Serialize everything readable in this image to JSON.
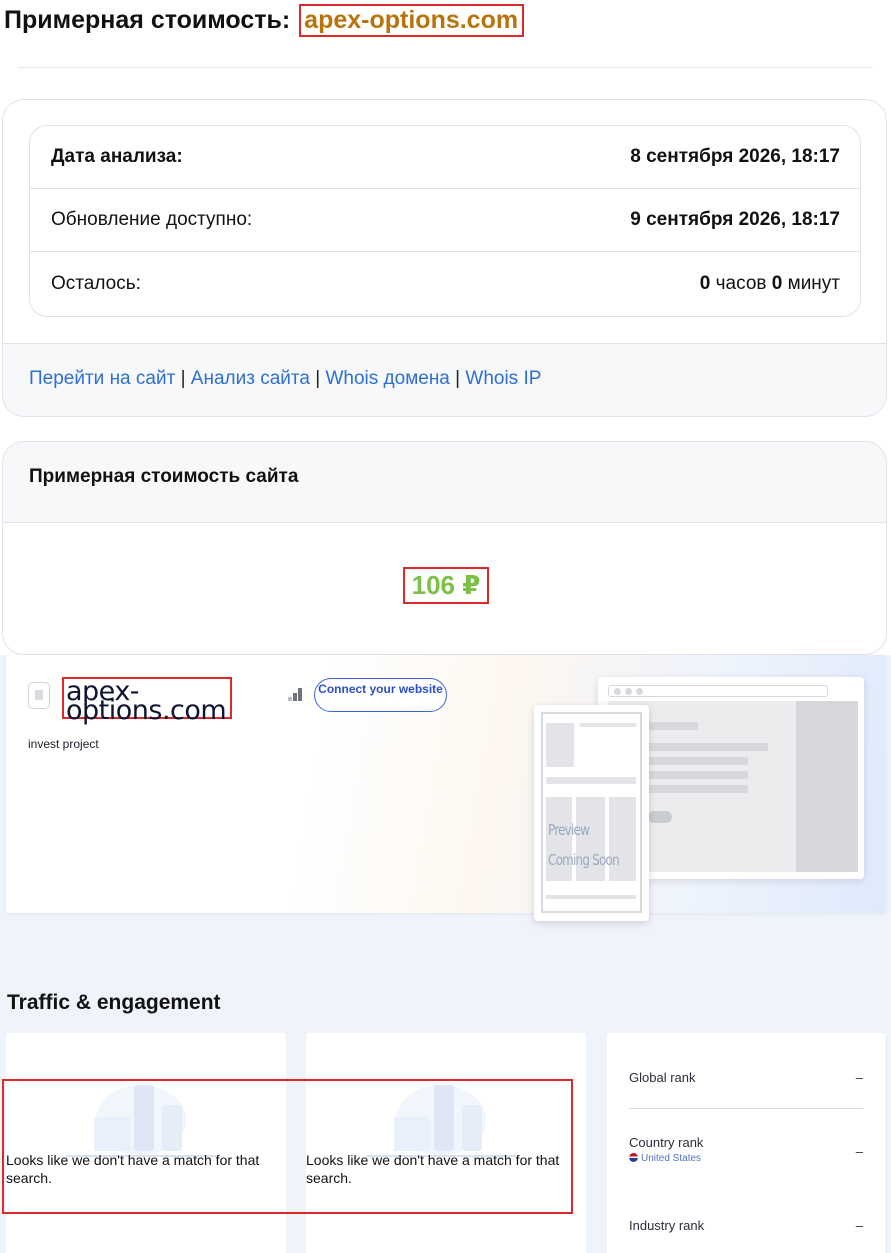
{
  "header": {
    "title_prefix": "Примерная стоимость:",
    "domain": "apex-options.com"
  },
  "analysis": {
    "date_label": "Дата анализа:",
    "date_value": "8 сентября 2026, 18:17",
    "update_label": "Обновление доступно:",
    "update_value": "9 сентября 2026, 18:17",
    "remaining_label": "Осталось:",
    "hours_value": "0",
    "hours_unit": "часов",
    "minutes_value": "0",
    "minutes_unit": "минут"
  },
  "links": {
    "goto_site": "Перейти на сайт",
    "site_analysis": "Анализ сайта",
    "whois_domain": "Whois домена",
    "whois_ip": "Whois IP",
    "separator": "|"
  },
  "value_card": {
    "title": "Примерная стоимость сайта",
    "price": "106 ₽"
  },
  "similarweb": {
    "domain": "apex-options.com",
    "connect_button": "Connect your website",
    "description": "invest project",
    "preview_line1": "Preview",
    "preview_line2": "Coming Soon",
    "section_title": "Traffic & engagement",
    "empty_message": "Looks like we don't have a match for that search.",
    "ranks": {
      "global_label": "Global rank",
      "global_value": "–",
      "country_label": "Country rank",
      "country_value": "–",
      "country_name": "United States",
      "industry_label": "Industry rank",
      "industry_value": "–"
    }
  },
  "colors": {
    "domain_accent": "#b8740c",
    "price_green": "#7cc04a",
    "link_blue": "#2f6fd4",
    "highlight_red": "#e02828"
  }
}
